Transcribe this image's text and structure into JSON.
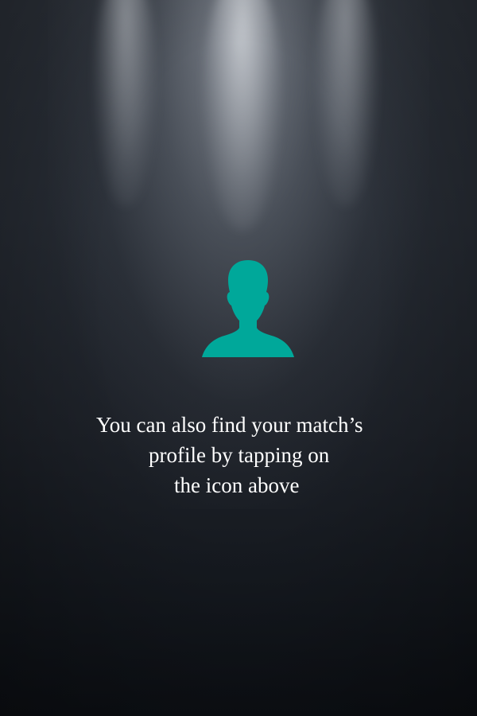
{
  "colors": {
    "icon_accent": "#00a89a",
    "text": "#ffffff",
    "background": "#1d2128"
  },
  "profile_icon": {
    "name": "person-silhouette-icon"
  },
  "hint": {
    "line1": "You can also find your match’s",
    "line2": "profile by tapping on",
    "line3": "the icon above"
  }
}
